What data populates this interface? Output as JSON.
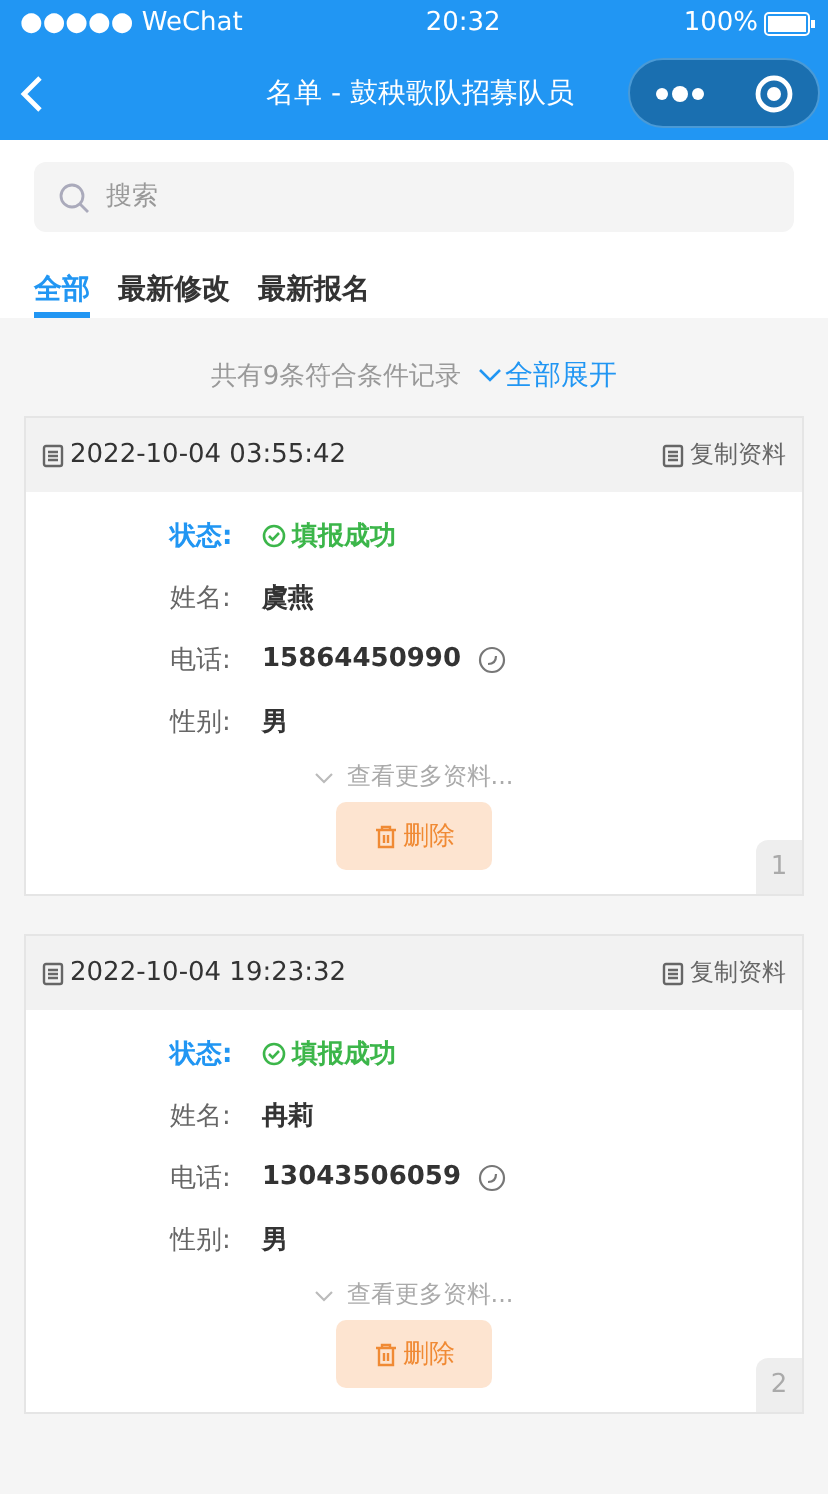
{
  "status_bar": {
    "carrier": "●●●●● WeChat",
    "time": "20:32",
    "battery": "100%"
  },
  "nav": {
    "title": "名单 - 鼓秧歌队招募队员"
  },
  "search": {
    "placeholder": "搜索"
  },
  "tabs": [
    {
      "label": "全部",
      "selected": true
    },
    {
      "label": "最新修改",
      "selected": false
    },
    {
      "label": "最新报名",
      "selected": false
    }
  ],
  "summary": {
    "text": "共有9条符合条件记录",
    "expand": "全部展开"
  },
  "records": [
    {
      "time": "2022-10-04 03:55:42",
      "copy": "复制资料",
      "fields": [
        {
          "kind": "status",
          "label": "状态:",
          "value": "填报成功"
        },
        {
          "kind": "text",
          "label": "姓名:",
          "value": "虞燕"
        },
        {
          "kind": "phone",
          "label": "电话:",
          "value": "15864450990"
        },
        {
          "kind": "text",
          "label": "性别:",
          "value": "男"
        }
      ],
      "more": "查看更多资料...",
      "delete": "删除",
      "index": "1"
    },
    {
      "time": "2022-10-04 19:23:32",
      "copy": "复制资料",
      "fields": [
        {
          "kind": "status",
          "label": "状态:",
          "value": "填报成功"
        },
        {
          "kind": "text",
          "label": "姓名:",
          "value": "冉莉"
        },
        {
          "kind": "phone",
          "label": "电话:",
          "value": "13043506059"
        },
        {
          "kind": "text",
          "label": "性别:",
          "value": "男"
        }
      ],
      "more": "查看更多资料...",
      "delete": "删除",
      "index": "2"
    }
  ]
}
